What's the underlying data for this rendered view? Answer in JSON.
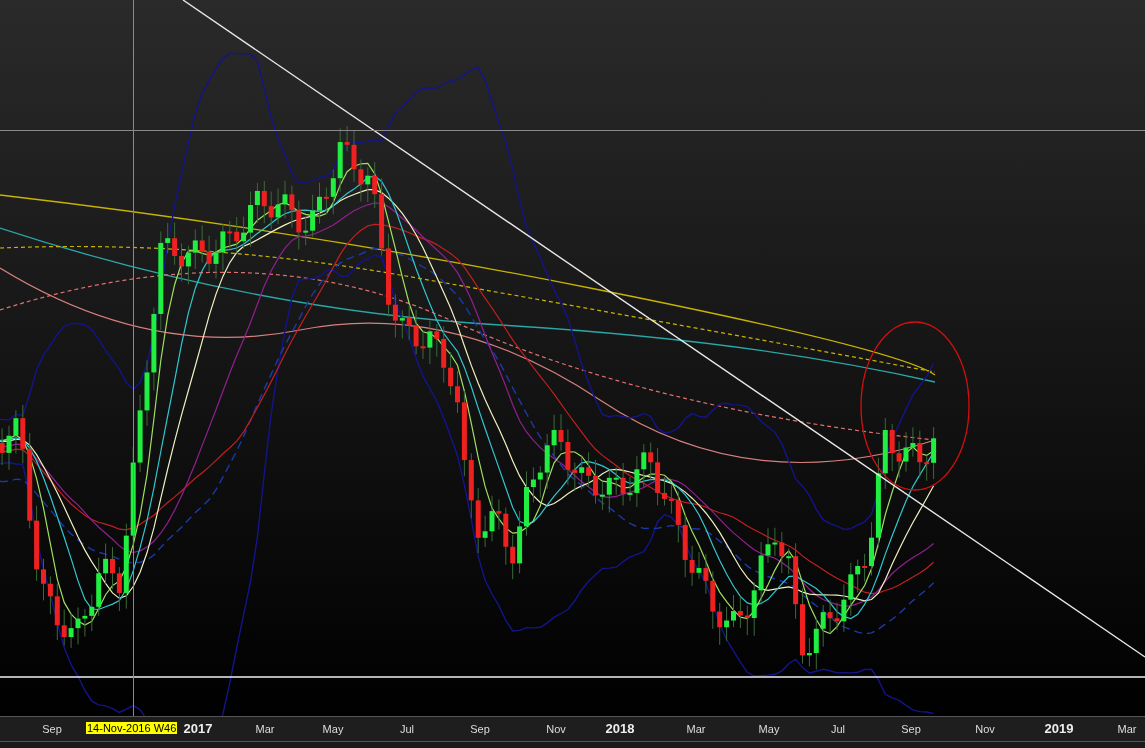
{
  "x_axis": {
    "crosshair_label": "14-Nov-2016 W46",
    "labels": [
      {
        "text": "Sep",
        "kind": "month"
      },
      {
        "text": "2017",
        "kind": "year"
      },
      {
        "text": "Mar",
        "kind": "month"
      },
      {
        "text": "May",
        "kind": "month"
      },
      {
        "text": "Jul",
        "kind": "month"
      },
      {
        "text": "Sep",
        "kind": "month"
      },
      {
        "text": "Nov",
        "kind": "month"
      },
      {
        "text": "2018",
        "kind": "year"
      },
      {
        "text": "Mar",
        "kind": "month"
      },
      {
        "text": "May",
        "kind": "month"
      },
      {
        "text": "Jul",
        "kind": "month"
      },
      {
        "text": "Sep",
        "kind": "month"
      },
      {
        "text": "Nov",
        "kind": "month"
      },
      {
        "text": "2019",
        "kind": "year"
      },
      {
        "text": "Mar",
        "kind": "month"
      }
    ]
  }
}
